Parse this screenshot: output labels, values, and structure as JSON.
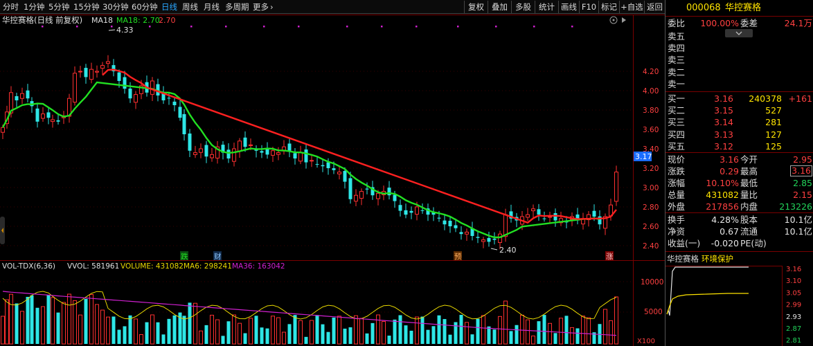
{
  "toolbar": {
    "periods": [
      "分时",
      "1分钟",
      "5分钟",
      "15分钟",
      "30分钟",
      "60分钟",
      "日线",
      "周线",
      "月线",
      "多周期",
      "更多"
    ],
    "active_period": "日线",
    "more_arrow": "›",
    "right_buttons": [
      "复权",
      "叠加",
      "多股",
      "统计",
      "画线",
      "F10",
      "标记",
      "+自选",
      "返回"
    ]
  },
  "kline": {
    "title": "华控赛格(日线 前复权)",
    "ma_label": "MA18",
    "ma_value_label": "MA18: 2.70",
    "ma_value2": "2.70",
    "high_note": "4.33",
    "low_note": "2.40",
    "y_ticks": [
      "4.20",
      "4.00",
      "3.80",
      "3.60",
      "3.40",
      "3.20",
      "3.00",
      "2.80",
      "2.60",
      "2.40"
    ],
    "y_tick_values": [
      4.2,
      4.0,
      3.8,
      3.6,
      3.4,
      3.2,
      3.0,
      2.8,
      2.6,
      2.4
    ],
    "current_price_tag": "3.17",
    "markers": [
      "跌",
      "财",
      "预",
      "涨"
    ],
    "colors": {
      "up": "#ff3030",
      "down": "#2ee6e6",
      "ma_up": "#ff2020",
      "ma_down": "#22e022"
    }
  },
  "volume": {
    "title": "VOL-TDX(6,36)",
    "vvol": "VVOL: 581961",
    "volume": "VOLUME: 431082",
    "ma6": "MA6: 298241",
    "ma36": "MA36: 163042",
    "y_ticks": [
      "10000",
      "5000"
    ],
    "unit": "X100"
  },
  "quote": {
    "code": "000068",
    "name": "华控赛格",
    "weibi_label": "委比",
    "weibi_value": "100.00%",
    "weicha_label": "委差",
    "weicha_value": "24.1万",
    "sell": [
      {
        "label": "卖五",
        "price": "",
        "vol": "",
        "chg": ""
      },
      {
        "label": "卖四",
        "price": "",
        "vol": "",
        "chg": ""
      },
      {
        "label": "卖三",
        "price": "",
        "vol": "",
        "chg": ""
      },
      {
        "label": "卖二",
        "price": "",
        "vol": "",
        "chg": ""
      },
      {
        "label": "卖一",
        "price": "",
        "vol": "",
        "chg": ""
      }
    ],
    "buy": [
      {
        "label": "买一",
        "price": "3.16",
        "vol": "240378",
        "chg": "+161"
      },
      {
        "label": "买二",
        "price": "3.15",
        "vol": "527",
        "chg": ""
      },
      {
        "label": "买三",
        "price": "3.14",
        "vol": "281",
        "chg": ""
      },
      {
        "label": "买四",
        "price": "3.13",
        "vol": "127",
        "chg": ""
      },
      {
        "label": "买五",
        "price": "3.12",
        "vol": "125",
        "chg": ""
      }
    ],
    "stats": [
      {
        "l1": "现价",
        "v1": "3.16",
        "l2": "今开",
        "v2": "2.95"
      },
      {
        "l1": "涨跌",
        "v1": "0.29",
        "l2": "最高",
        "v2": "3.16"
      },
      {
        "l1": "涨幅",
        "v1": "10.10%",
        "l2": "最低",
        "v2": "2.85"
      },
      {
        "l1": "总量",
        "v1": "431082",
        "l2": "量比",
        "v2": "2.15"
      },
      {
        "l1": "外盘",
        "v1": "217856",
        "l2": "内盘",
        "v2": "213226"
      }
    ],
    "stats2": [
      {
        "l1": "换手",
        "v1": "4.28%",
        "l2": "股本",
        "v2": "10.1亿"
      },
      {
        "l1": "净资",
        "v1": "0.67",
        "l2": "流通",
        "v2": "10.1亿"
      },
      {
        "l1": "收益(一)",
        "v1": "-0.020",
        "l2": "PE(动)",
        "v2": ""
      }
    ]
  },
  "mini": {
    "title": "华控赛格",
    "tag": "环境保护",
    "y_ticks": [
      "3.16",
      "3.10",
      "3.05",
      "2.99",
      "2.93",
      "2.87",
      "2.81"
    ]
  }
}
